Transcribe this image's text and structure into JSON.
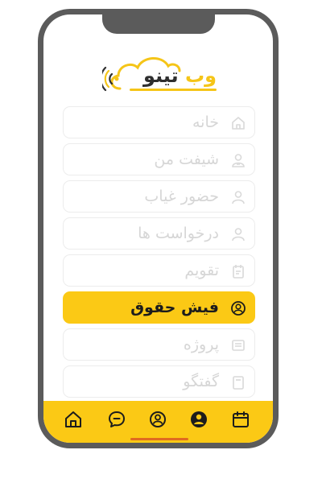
{
  "app": {
    "logo_text_accent": "وب",
    "logo_text_main": "تینو"
  },
  "menu": {
    "items": [
      {
        "label": "خانه",
        "icon": "home-icon",
        "active": false
      },
      {
        "label": "شیفت من",
        "icon": "user-shift-icon",
        "active": false
      },
      {
        "label": "حضور غیاب",
        "icon": "user-icon",
        "active": false
      },
      {
        "label": "درخواست ها",
        "icon": "user-icon",
        "active": false
      },
      {
        "label": "تقویم",
        "icon": "clipboard-icon",
        "active": false
      },
      {
        "label": "فیش حقوق",
        "icon": "user-circle-icon",
        "active": true
      },
      {
        "label": "پروژه",
        "icon": "document-icon",
        "active": false
      },
      {
        "label": "گفتگو",
        "icon": "note-icon",
        "active": false
      }
    ]
  },
  "tabbar": {
    "tabs": [
      "calendar-icon",
      "profile-filled-icon",
      "user-circle-icon",
      "chat-icon",
      "home-icon"
    ]
  },
  "colors": {
    "accent": "#fbc915",
    "frame": "#5b5b5b",
    "inactive_text": "#d6d6d6",
    "active_text": "#1c1c1c",
    "home_indicator": "#e06a1f"
  }
}
